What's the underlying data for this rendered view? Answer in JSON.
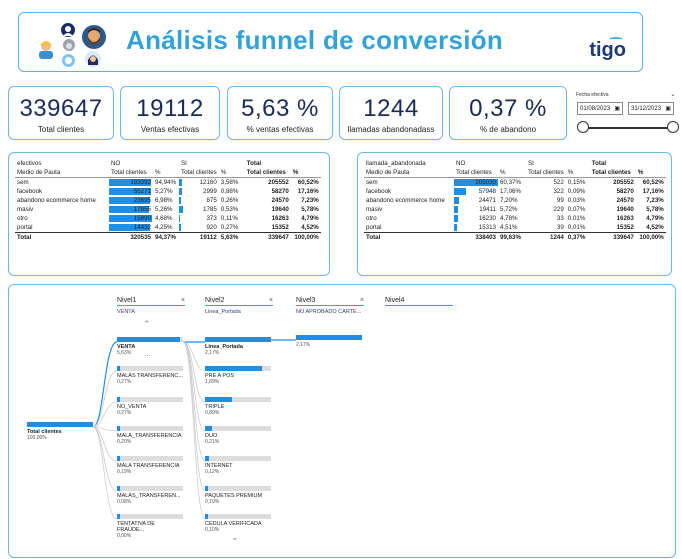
{
  "header": {
    "title": "Análisis funnel de conversión",
    "logo": "tigo"
  },
  "kpis": [
    {
      "value": "339647",
      "label": "Total clientes"
    },
    {
      "value": "19112",
      "label": "Ventas efectivas"
    },
    {
      "value": "5,63 %",
      "label": "% ventas efectivas"
    },
    {
      "value": "1244",
      "label": "llamadas abandonadass"
    },
    {
      "value": "0,37 %",
      "label": "% de abandono"
    }
  ],
  "date_filter": {
    "label": "Fecha efectiva",
    "start": "01/08/2023",
    "end": "31/12/2023"
  },
  "matrix1": {
    "corner1": "efectivos",
    "corner2": "Medio de Pauta",
    "group_no": "NO",
    "group_si": "SI",
    "group_total": "Total",
    "sub": {
      "clientes": "Total clientes",
      "pct": "%"
    },
    "rows": [
      {
        "name": "sem",
        "no_c": "193392",
        "no_p": "94,94%",
        "no_f": 0.95,
        "si_c": "12160",
        "si_p": "3,58%",
        "si_f": 0.07,
        "t_c": "205552",
        "t_p": "60,52%"
      },
      {
        "name": "facebook",
        "no_c": "55271",
        "no_p": "5,27%",
        "no_f": 0.95,
        "si_c": "2999",
        "si_p": "0,88%",
        "si_f": 0.07,
        "t_c": "58270",
        "t_p": "17,16%"
      },
      {
        "name": "abandono ecommerce home",
        "no_c": "23695",
        "no_p": "6,98%",
        "no_f": 0.93,
        "si_c": "875",
        "si_p": "0,26%",
        "si_f": 0.04,
        "t_c": "24570",
        "t_p": "7,23%"
      },
      {
        "name": "masiv",
        "no_c": "17855",
        "no_p": "5,26%",
        "no_f": 0.91,
        "si_c": "1785",
        "si_p": "0,53%",
        "si_f": 0.09,
        "t_c": "19640",
        "t_p": "5,78%"
      },
      {
        "name": "otro",
        "no_c": "15890",
        "no_p": "4,68%",
        "no_f": 0.98,
        "si_c": "373",
        "si_p": "0,11%",
        "si_f": 0.02,
        "t_c": "16263",
        "t_p": "4,79%"
      },
      {
        "name": "portal",
        "no_c": "14432",
        "no_p": "4,25%",
        "no_f": 0.94,
        "si_c": "920",
        "si_p": "0,27%",
        "si_f": 0.06,
        "t_c": "15352",
        "t_p": "4,52%"
      }
    ],
    "total": {
      "name": "Total",
      "no_c": "320535",
      "no_p": "94,37%",
      "si_c": "19112",
      "si_p": "5,63%",
      "t_c": "339647",
      "t_p": "100,00%"
    }
  },
  "matrix2": {
    "corner1": "llamada_abandonada",
    "corner2": "Medio de Pauta",
    "group_no": "NO",
    "group_si": "SI",
    "group_total": "Total",
    "sub": {
      "clientes": "Total clientes",
      "pct": "%"
    },
    "rows": [
      {
        "name": "sem",
        "no_c": "205030",
        "no_p": "60,37%",
        "no_f": 1.0,
        "si_c": "522",
        "si_p": "0,15%",
        "t_c": "205552",
        "t_p": "60,52%"
      },
      {
        "name": "facebook",
        "no_c": "57948",
        "no_p": "17,06%",
        "no_f": 0.28,
        "si_c": "322",
        "si_p": "0,09%",
        "t_c": "58270",
        "t_p": "17,16%"
      },
      {
        "name": "abandono ecommerce home",
        "no_c": "24471",
        "no_p": "7,20%",
        "no_f": 0.12,
        "si_c": "99",
        "si_p": "0,03%",
        "t_c": "24570",
        "t_p": "7,23%"
      },
      {
        "name": "masiv",
        "no_c": "19411",
        "no_p": "5,72%",
        "no_f": 0.09,
        "si_c": "229",
        "si_p": "0,07%",
        "t_c": "19640",
        "t_p": "5,78%"
      },
      {
        "name": "otro",
        "no_c": "16230",
        "no_p": "4,78%",
        "no_f": 0.08,
        "si_c": "33",
        "si_p": "0,01%",
        "t_c": "16263",
        "t_p": "4,79%"
      },
      {
        "name": "portal",
        "no_c": "15313",
        "no_p": "4,51%",
        "no_f": 0.07,
        "si_c": "39",
        "si_p": "0,01%",
        "t_c": "15352",
        "t_p": "4,52%"
      }
    ],
    "total": {
      "name": "Total",
      "no_c": "338403",
      "no_p": "99,63%",
      "si_c": "1244",
      "si_p": "0,37%",
      "t_c": "339647",
      "t_p": "100,00%"
    }
  },
  "tree": {
    "root": {
      "label": "Total clientes",
      "pct": "100,00%"
    },
    "levels": [
      {
        "name": "Nivel1",
        "sub": "VENTA"
      },
      {
        "name": "Nivel2",
        "sub": "Linea_Portada"
      },
      {
        "name": "Nivel3",
        "sub": "NO APROBADO CARTE..."
      },
      {
        "name": "Nivel4",
        "sub": ""
      }
    ],
    "level1": [
      {
        "label": "VENTA",
        "pct": "5,63%",
        "fill": 0.95,
        "selected": true
      },
      {
        "label": "MALAS TRANSFERENC...",
        "pct": "0,27%",
        "fill": 0.05
      },
      {
        "label": "NO_VENTA",
        "pct": "0,27%",
        "fill": 0.05
      },
      {
        "label": "MALA_TRANSFERENCIA",
        "pct": "0,20%",
        "fill": 0.04
      },
      {
        "label": "MALA TRANSFERENCIA",
        "pct": "0,19%",
        "fill": 0.04
      },
      {
        "label": "MALAS_TRANSFEREN...",
        "pct": "0,08%",
        "fill": 0.02
      },
      {
        "label": "TENTATIVA DE FRAUDE...",
        "pct": "0,00%",
        "fill": 0.01
      }
    ],
    "level2": [
      {
        "label": "Linea_Portada",
        "pct": "2,17%",
        "fill": 1.0,
        "selected": true
      },
      {
        "label": "PRE A POS",
        "pct": "1,89%",
        "fill": 0.87
      },
      {
        "label": "TRIPLE",
        "pct": "0,89%",
        "fill": 0.41
      },
      {
        "label": "DUO",
        "pct": "0,21%",
        "fill": 0.1
      },
      {
        "label": "INTERNET",
        "pct": "0,12%",
        "fill": 0.06
      },
      {
        "label": "PAQUETES PREMIUM",
        "pct": "0,10%",
        "fill": 0.05
      },
      {
        "label": "CEDULA VERIFICADA",
        "pct": "0,10%",
        "fill": 0.05
      }
    ],
    "level3": [
      {
        "label": "",
        "pct": "2,17%",
        "fill": 1.0
      }
    ]
  },
  "colors": {
    "accent": "#33a2d8",
    "bar": "#1f8fe6",
    "navy": "#1a2a5a"
  }
}
